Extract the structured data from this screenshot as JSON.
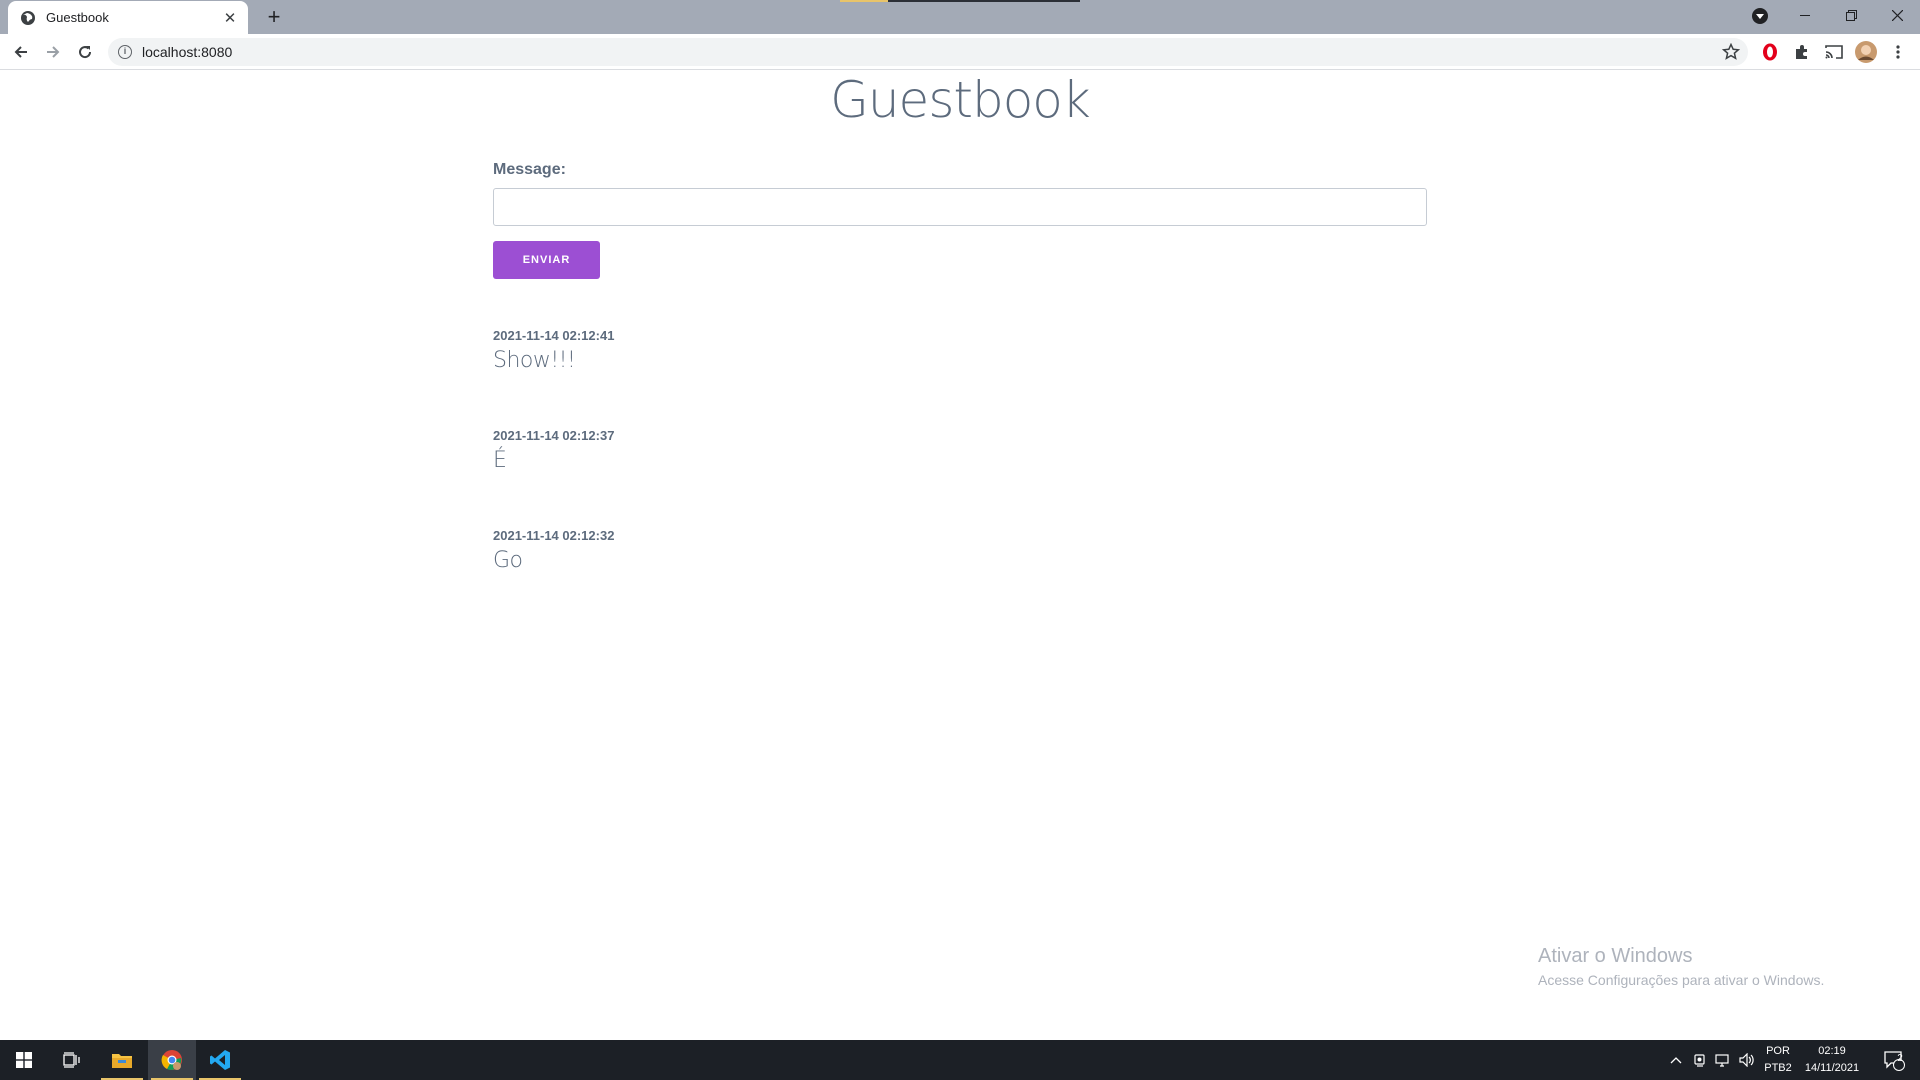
{
  "browser": {
    "tab_title": "Guestbook",
    "url": "localhost:8080"
  },
  "page": {
    "title": "Guestbook",
    "form": {
      "label": "Message:",
      "input_value": "",
      "submit_label": "ENVIAR"
    },
    "entries": [
      {
        "timestamp": "2021-11-14 02:12:41",
        "message": "Show!!!"
      },
      {
        "timestamp": "2021-11-14 02:12:37",
        "message": "É"
      },
      {
        "timestamp": "2021-11-14 02:12:32",
        "message": "Go"
      }
    ]
  },
  "watermark": {
    "title": "Ativar o Windows",
    "subtitle": "Acesse Configurações para ativar o Windows."
  },
  "taskbar": {
    "lang_top": "POR",
    "lang_bottom": "PTB2",
    "time": "02:19",
    "date": "14/11/2021",
    "notification_count": "2"
  },
  "colors": {
    "accent_button": "#9c4fd3",
    "text": "#5d6b7d",
    "tabstrip": "#a3aab6",
    "taskbar": "#1c2026"
  }
}
